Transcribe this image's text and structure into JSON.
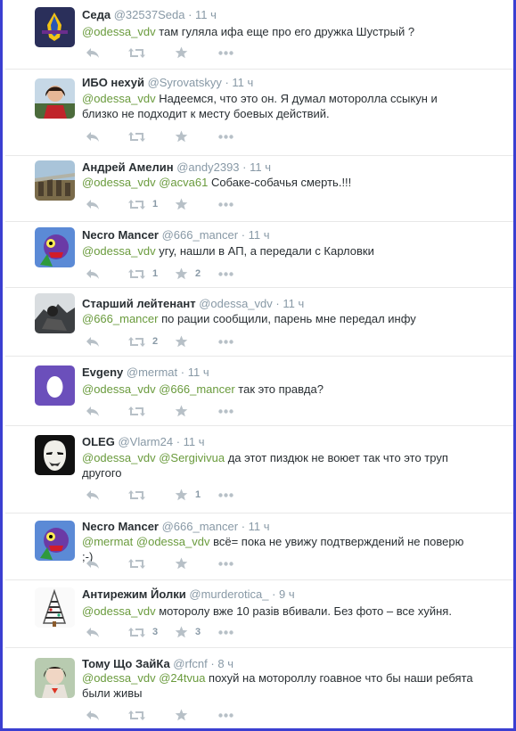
{
  "tweets": [
    {
      "name": "Седа",
      "handle": "@32537Seda",
      "time": "· 11 ч",
      "mentions": [
        "@odessa_vdv"
      ],
      "text": " там гуляла ифа еще про его дружка Шустрый ?",
      "retweets": "",
      "favorites": ""
    },
    {
      "name": "ИБО нехуй",
      "handle": "@Syrovatskyy",
      "time": "· 11 ч",
      "mentions": [
        "@odessa_vdv"
      ],
      "text": " Надеемся, что это он. Я думал моторолла ссыкун и близко не подходит к месту боевых действий.",
      "retweets": "",
      "favorites": ""
    },
    {
      "name": "Андрей Амелин",
      "handle": "@andy2393",
      "time": "· 11 ч",
      "mentions": [
        "@odessa_vdv",
        "@acva61"
      ],
      "text": " Собаке-собачья смерть.!!!",
      "retweets": "1",
      "favorites": ""
    },
    {
      "name": "Necro Mancer",
      "handle": "@666_mancer",
      "time": "· 11 ч",
      "mentions": [
        "@odessa_vdv"
      ],
      "text": " угу, нашли в АП, а передали с Карловки",
      "retweets": "1",
      "favorites": "2"
    },
    {
      "name": "Старший лейтенант",
      "handle": "@odessa_vdv",
      "time": "· 11 ч",
      "mentions": [
        "@666_mancer"
      ],
      "text": " по рации сообщили, парень мне передал инфу",
      "retweets": "2",
      "favorites": ""
    },
    {
      "name": "Evgeny",
      "handle": "@mermat",
      "time": "· 11 ч",
      "mentions": [
        "@odessa_vdv",
        "@666_mancer"
      ],
      "text": " так это правда?",
      "retweets": "",
      "favorites": ""
    },
    {
      "name": "OLEG",
      "handle": "@Vlarm24",
      "time": "· 11 ч",
      "mentions": [
        "@odessa_vdv",
        "@Sergivivua"
      ],
      "text": " да этот пиздюк не воюет так что это труп другого",
      "retweets": "",
      "favorites": "1"
    },
    {
      "name": "Necro Mancer",
      "handle": "@666_mancer",
      "time": "· 11 ч",
      "mentions": [
        "@mermat",
        "@odessa_vdv"
      ],
      "text": " всё= пока не увижу подтверждений не поверю ;-)",
      "retweets": "",
      "favorites": ""
    },
    {
      "name": "Антирежим Йолки",
      "handle": "@murderotica_",
      "time": "· 9 ч",
      "mentions": [
        "@odessa_vdv"
      ],
      "text": " моторолу вже 10 разів вбивали. Без фото – все хуйня.",
      "retweets": "3",
      "favorites": "3"
    },
    {
      "name": "Тому Що ЗайКа",
      "handle": "@rfcnf",
      "time": "· 8 ч",
      "mentions": [
        "@odessa_vdv",
        "@24tvua"
      ],
      "text": " похуй на мотороллу гоавное что бы наши ребята были живы",
      "retweets": "",
      "favorites": ""
    }
  ],
  "icons": {
    "reply": "reply-icon",
    "retweet": "retweet-icon",
    "favorite": "star-icon",
    "more": "more-icon"
  },
  "colors": {
    "mention": "#6a9b3d",
    "border": "#3b3fd1",
    "icon": "#b7c0c7"
  }
}
